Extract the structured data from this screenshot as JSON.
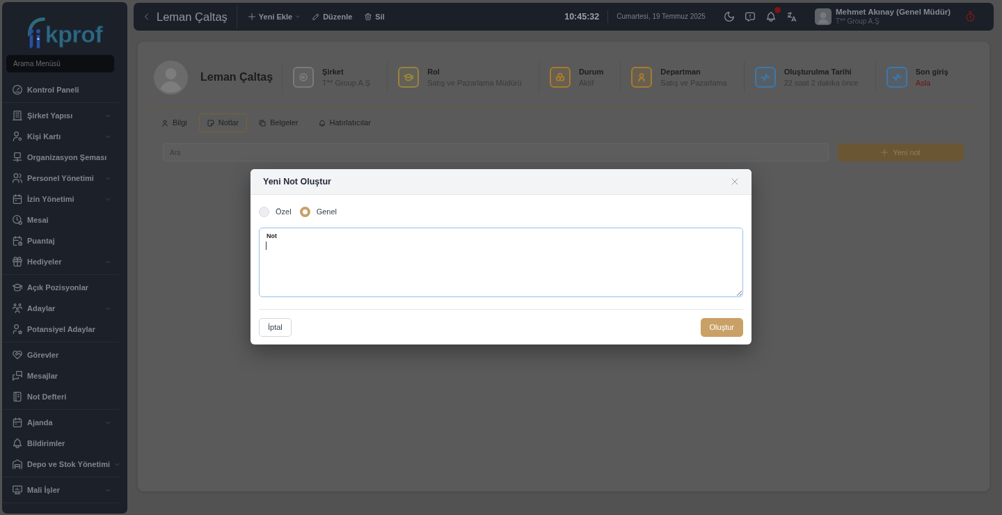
{
  "sidebar": {
    "logo": "kprof",
    "search": {
      "placeholder": "Arama Menüsü"
    },
    "sections": [
      {
        "items": [
          {
            "label": "Kontrol Paneli",
            "expandable": false
          }
        ]
      },
      {
        "items": [
          {
            "label": "Şirket Yapısı",
            "expandable": true
          },
          {
            "label": "Kişi Kartı",
            "expandable": true
          },
          {
            "label": "Organizasyon Şeması",
            "expandable": false
          },
          {
            "label": "Personel Yönetimi",
            "expandable": true
          },
          {
            "label": "İzin Yönetimi",
            "expandable": true
          },
          {
            "label": "Mesai",
            "expandable": false
          },
          {
            "label": "Puantaj",
            "expandable": false
          },
          {
            "label": "Hediyeler",
            "expandable": true
          }
        ]
      },
      {
        "items": [
          {
            "label": "Açık Pozisyonlar",
            "expandable": false
          },
          {
            "label": "Adaylar",
            "expandable": true
          },
          {
            "label": "Potansiyel Adaylar",
            "expandable": false
          }
        ]
      },
      {
        "items": [
          {
            "label": "Görevler",
            "expandable": false
          },
          {
            "label": "Mesajlar",
            "expandable": false
          },
          {
            "label": "Not Defteri",
            "expandable": false
          }
        ]
      },
      {
        "items": [
          {
            "label": "Ajanda",
            "expandable": true
          },
          {
            "label": "Bildirimler",
            "expandable": false
          },
          {
            "label": "Depo ve Stok Yönetimi",
            "expandable": true
          }
        ]
      },
      {
        "items": [
          {
            "label": "Mali İşler",
            "expandable": true
          }
        ]
      }
    ]
  },
  "topbar": {
    "title": "Leman Çaltaş",
    "actions": [
      {
        "label": "Yeni Ekle",
        "dropdown": true
      },
      {
        "label": "Düzenle",
        "dropdown": false
      },
      {
        "label": "Sil",
        "dropdown": false
      }
    ],
    "time": "10:45:32",
    "date": "Cumartesi, 19 Temmuz 2025",
    "unread_notifications": true,
    "user": {
      "name": "Mehmet Akınay (Genel Müdür)",
      "company": "T** Group A.Ş"
    }
  },
  "profile": {
    "name": "Leman Çaltaş",
    "facts": [
      {
        "label": "Şirket",
        "value": "T** Group A.Ş",
        "color": "#7a7a7a",
        "alert": false
      },
      {
        "label": "Rol",
        "value": "Satış ve Pazarlama Müdürü",
        "color": "#978340",
        "alert": false
      },
      {
        "label": "Durum",
        "value": "Aktif",
        "color": "#a87a2e",
        "alert": false
      },
      {
        "label": "Departman",
        "value": "Satış ve Pazarlama",
        "color": "#a87a2e",
        "alert": false
      },
      {
        "label": "Oluşturulma Tarihi",
        "value": "22 saat 2 dakika önce",
        "color": "#3f77a8",
        "alert": false
      },
      {
        "label": "Son giriş",
        "value": "Asla",
        "color": "#3f77a8",
        "alert": true
      }
    ]
  },
  "tabs": [
    {
      "label": "Bilgi",
      "selected": false
    },
    {
      "label": "Notlar",
      "selected": true
    },
    {
      "label": "Belgeler",
      "selected": false
    },
    {
      "label": "Hatırlatıcılar",
      "selected": false
    }
  ],
  "notes": {
    "search": {
      "placeholder": "Ara"
    },
    "new_button": "Yeni not"
  },
  "modal": {
    "title": "Yeni Not Oluştur",
    "visibility": [
      {
        "label": "Özel",
        "selected": false
      },
      {
        "label": "Genel",
        "selected": true
      }
    ],
    "note": {
      "label": "Not"
    },
    "buttons": [
      {
        "label": "İptal",
        "kind": "secondary"
      },
      {
        "label": "Oluştur",
        "kind": "primary"
      }
    ]
  }
}
